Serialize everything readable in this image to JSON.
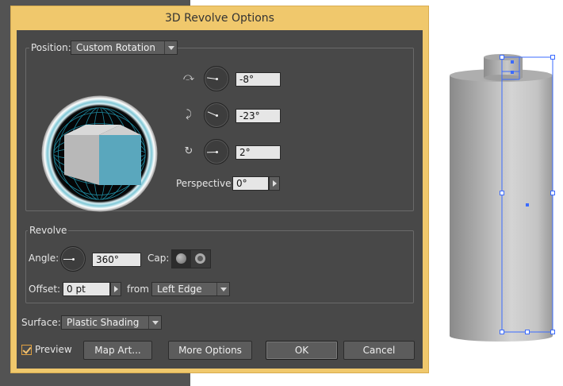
{
  "dialog": {
    "title": "3D Revolve Options",
    "position": {
      "label": "Position:",
      "preset": "Custom Rotation",
      "rotations": [
        {
          "axis": "x",
          "icon": "rotate-x-icon",
          "value": "-8°",
          "angle": -8
        },
        {
          "axis": "y",
          "icon": "rotate-y-icon",
          "value": "-23°",
          "angle": -23
        },
        {
          "axis": "z",
          "icon": "rotate-z-icon",
          "value": "2°",
          "angle": 2
        }
      ],
      "perspective_label": "Perspective:",
      "perspective_value": "0°"
    },
    "revolve": {
      "group_label": "Revolve",
      "angle_label": "Angle:",
      "angle_value": "360°",
      "cap_label": "Cap:",
      "offset_label": "Offset:",
      "offset_value": "0 pt",
      "from_label": "from",
      "from_value": "Left Edge"
    },
    "surface": {
      "label": "Surface:",
      "value": "Plastic Shading"
    },
    "footer": {
      "preview_label": "Preview",
      "preview_checked": true,
      "map_art_label": "Map Art...",
      "more_options_label": "More Options",
      "ok_label": "OK",
      "cancel_label": "Cancel"
    }
  },
  "colors": {
    "dialog_frame": "#f0c86c",
    "dialog_bg": "#484848",
    "cube_front": "#5aa7bd",
    "selection": "#3b6bff"
  }
}
